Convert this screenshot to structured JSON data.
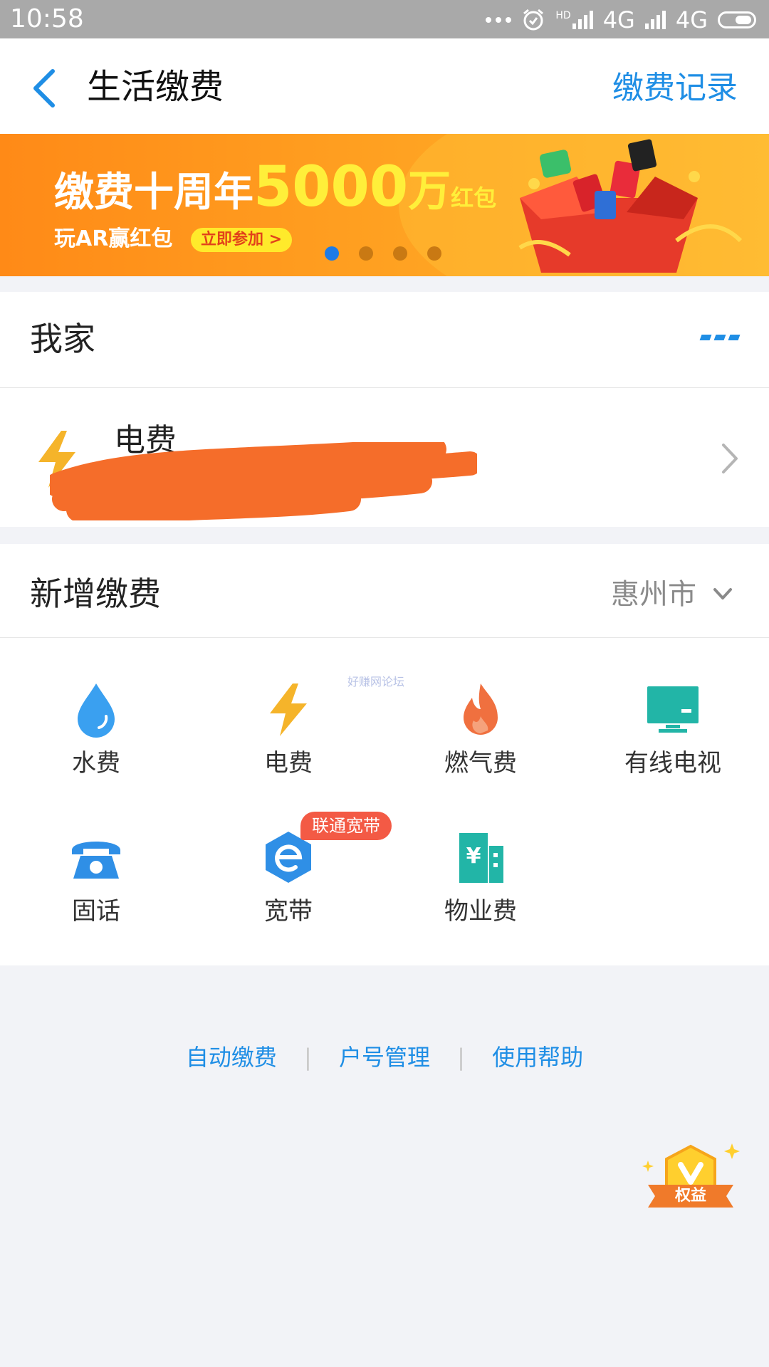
{
  "status_bar": {
    "time": "10:58",
    "hd": "HD",
    "network1": "4G",
    "network2": "4G"
  },
  "header": {
    "back_icon": "chevron-left-icon",
    "title": "生活缴费",
    "record_link": "缴费记录"
  },
  "banner": {
    "title_a": "缴费十周年",
    "title_b": "5000",
    "title_c": "万",
    "title_d": "红包",
    "subtitle": "玩AR赢红包",
    "cta": "立即参加 >",
    "page_count": 4,
    "active_page": 1
  },
  "home": {
    "title": "我家",
    "more_icon": "more-icon",
    "bill": {
      "icon": "lightning-icon",
      "label": "电费",
      "chevron": "chevron-right-icon"
    }
  },
  "new_payment": {
    "title": "新增缴费",
    "city": "惠州市",
    "items": [
      {
        "label": "水费",
        "icon": "water-drop-icon",
        "color": "#3aa0f0"
      },
      {
        "label": "电费",
        "icon": "lightning-icon",
        "color": "#f5b42a"
      },
      {
        "label": "燃气费",
        "icon": "flame-icon",
        "color": "#f0703f"
      },
      {
        "label": "有线电视",
        "icon": "tv-icon",
        "color": "#22b5a7"
      },
      {
        "label": "固话",
        "icon": "telephone-icon",
        "color": "#2f8fe6"
      },
      {
        "label": "宽带",
        "icon": "broadband-icon",
        "color": "#2f8fe6"
      },
      {
        "label": "物业费",
        "icon": "building-icon",
        "color": "#22b5a7"
      }
    ],
    "broadband_badge": "联通宽带",
    "watermark": "好赚网论坛"
  },
  "footer_links": [
    "自动缴费",
    "户号管理",
    "使用帮助"
  ],
  "perk_badge": "权益",
  "colors": {
    "accent": "#1f8ee5",
    "banner_orange": "#ff8a17",
    "badge_red": "#f35a45"
  }
}
